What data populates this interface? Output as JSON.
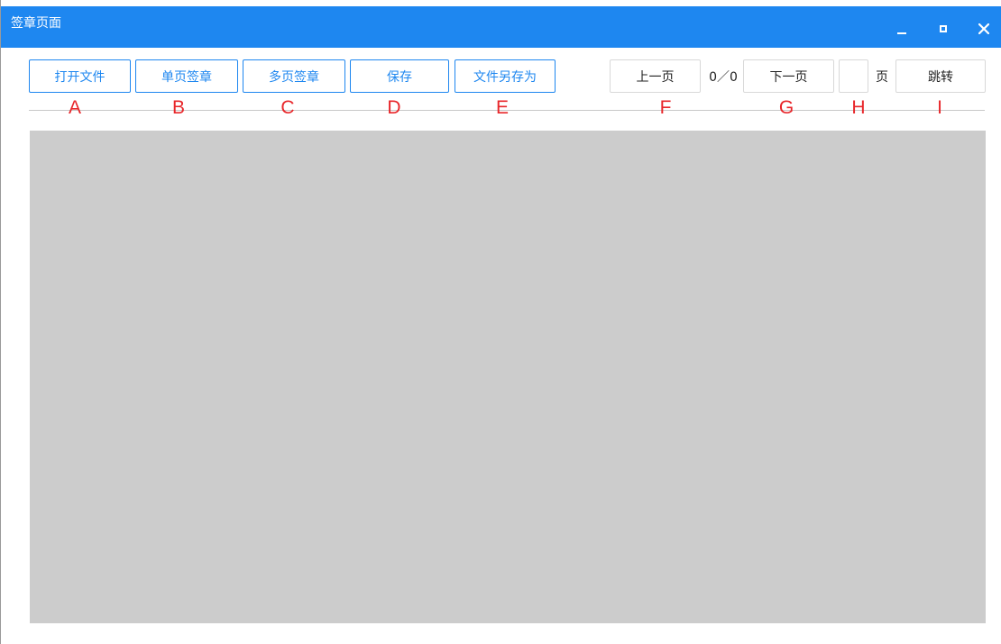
{
  "window": {
    "title": "签章页面"
  },
  "toolbar": {
    "open_file": "打开文件",
    "single_page_sign": "单页签章",
    "multi_page_sign": "多页签章",
    "save": "保存",
    "save_as": "文件另存为",
    "prev_page": "上一页",
    "page_indicator": "0／0",
    "next_page": "下一页",
    "page_input_value": "",
    "page_unit": "页",
    "jump": "跳转"
  },
  "annotations": {
    "a": "A",
    "b": "B",
    "c": "C",
    "d": "D",
    "e": "E",
    "f": "F",
    "g": "G",
    "h": "H",
    "i": "I"
  },
  "colors": {
    "titlebar": "#1e87f0",
    "accent": "#1e87f0",
    "annotation": "#e8262a",
    "canvas": "#cccccc"
  },
  "icons": {
    "minimize": "minimize-icon",
    "maximize": "maximize-icon",
    "close": "close-icon"
  }
}
